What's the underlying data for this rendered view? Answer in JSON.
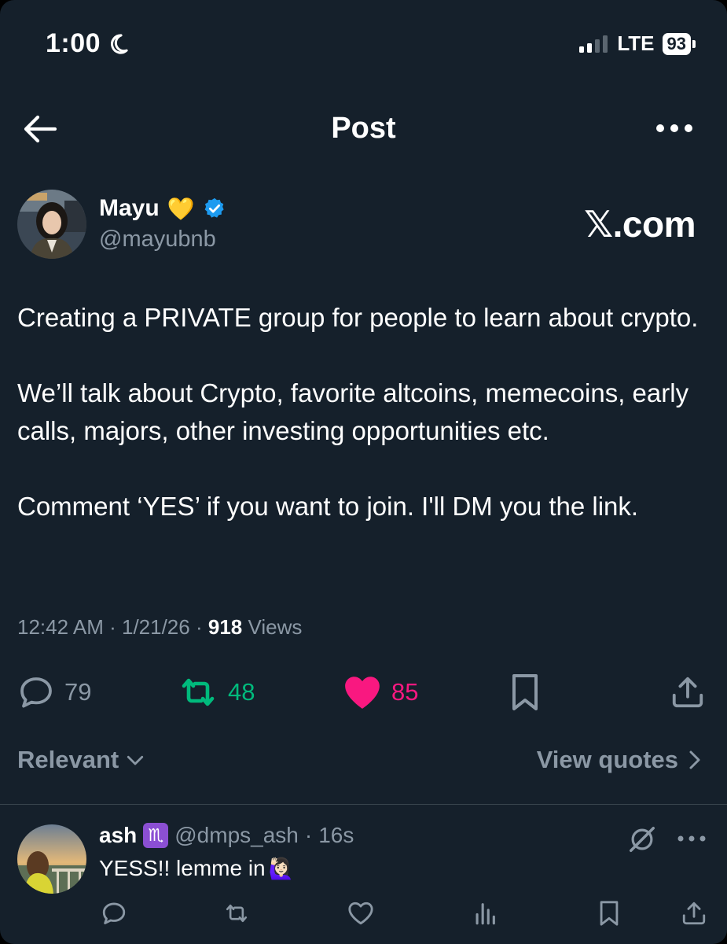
{
  "status_bar": {
    "time": "1:00",
    "network": "LTE",
    "battery": "93"
  },
  "header": {
    "title": "Post"
  },
  "post": {
    "author_name": "Mayu",
    "author_emoji": "💛",
    "handle": "@mayubnb",
    "brand_label": "𝕏.com",
    "body": [
      "Creating a PRIVATE group for people to learn about crypto.",
      "We’ll talk about Crypto, favorite altcoins, memecoins, early calls, majors, other investing opportunities etc.",
      "Comment ‘YES’ if you want to join. I'll DM you the link."
    ],
    "time": "12:42 AM",
    "date": "1/21/26",
    "views_count": "918",
    "views_label": "Views",
    "replies": "79",
    "reposts": "48",
    "likes": "85"
  },
  "replies_bar": {
    "sort_label": "Relevant",
    "quotes_label": "View quotes"
  },
  "reply": {
    "name": "ash",
    "badge": "♏",
    "handle": "@dmps_ash",
    "time": "16s",
    "text": "YESS!! lemme in",
    "emoji": "🙋🏻‍♀️"
  },
  "colors": {
    "background": "#15202b",
    "repost": "#00ba7c",
    "like": "#f91880",
    "verified": "#1d9bf0",
    "muted": "#8b98a5"
  }
}
